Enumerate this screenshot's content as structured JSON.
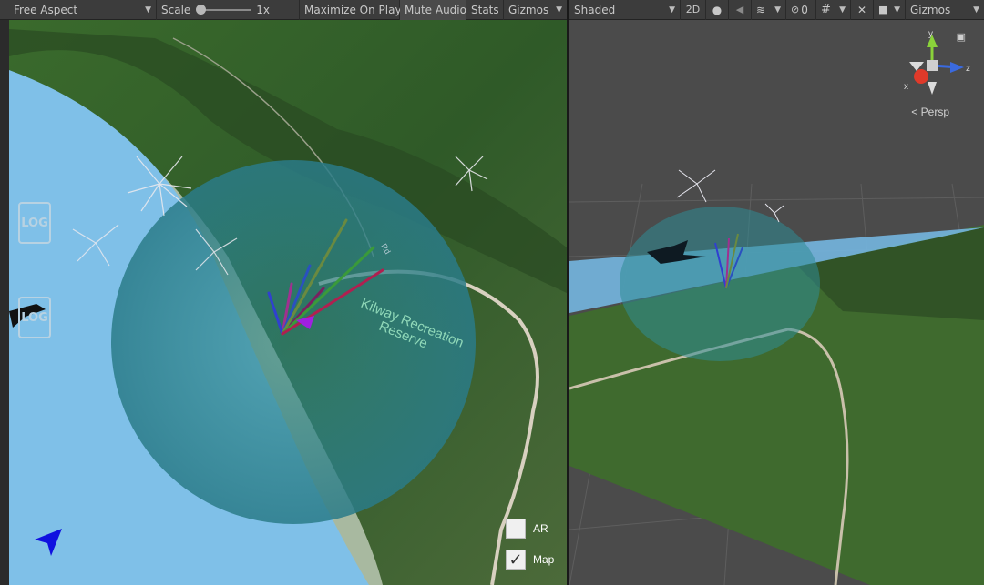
{
  "game_toolbar": {
    "aspect": "Free Aspect",
    "scale_label": "Scale",
    "scale_value": "1x",
    "maximize": "Maximize On Play",
    "mute": "Mute Audio",
    "stats": "Stats",
    "gizmos": "Gizmos"
  },
  "scene_toolbar": {
    "shading": "Shaded",
    "mode_2d": "2D",
    "hidden_count": "0",
    "gizmos": "Gizmos"
  },
  "map": {
    "reserve_line1": "Kilway Recreation",
    "reserve_line2": "Reserve",
    "road_label": "Rd"
  },
  "overlay": {
    "log_badge": "LOG",
    "toggle_ar": "AR",
    "toggle_map": "Map",
    "map_checked": true,
    "ar_checked": false
  },
  "gizmo": {
    "x": "x",
    "y": "y",
    "z": "z",
    "persp": "Persp"
  },
  "colors": {
    "toolbar_bg": "#3c3c3c",
    "water": "#7fc0e8",
    "sphere": "#2f8d95",
    "land": "#3e6a2f",
    "nav_arrow": "#1010e0",
    "gizmo_x": "#e03a2a",
    "gizmo_y": "#8ad23a",
    "gizmo_z": "#3a6ae0"
  }
}
